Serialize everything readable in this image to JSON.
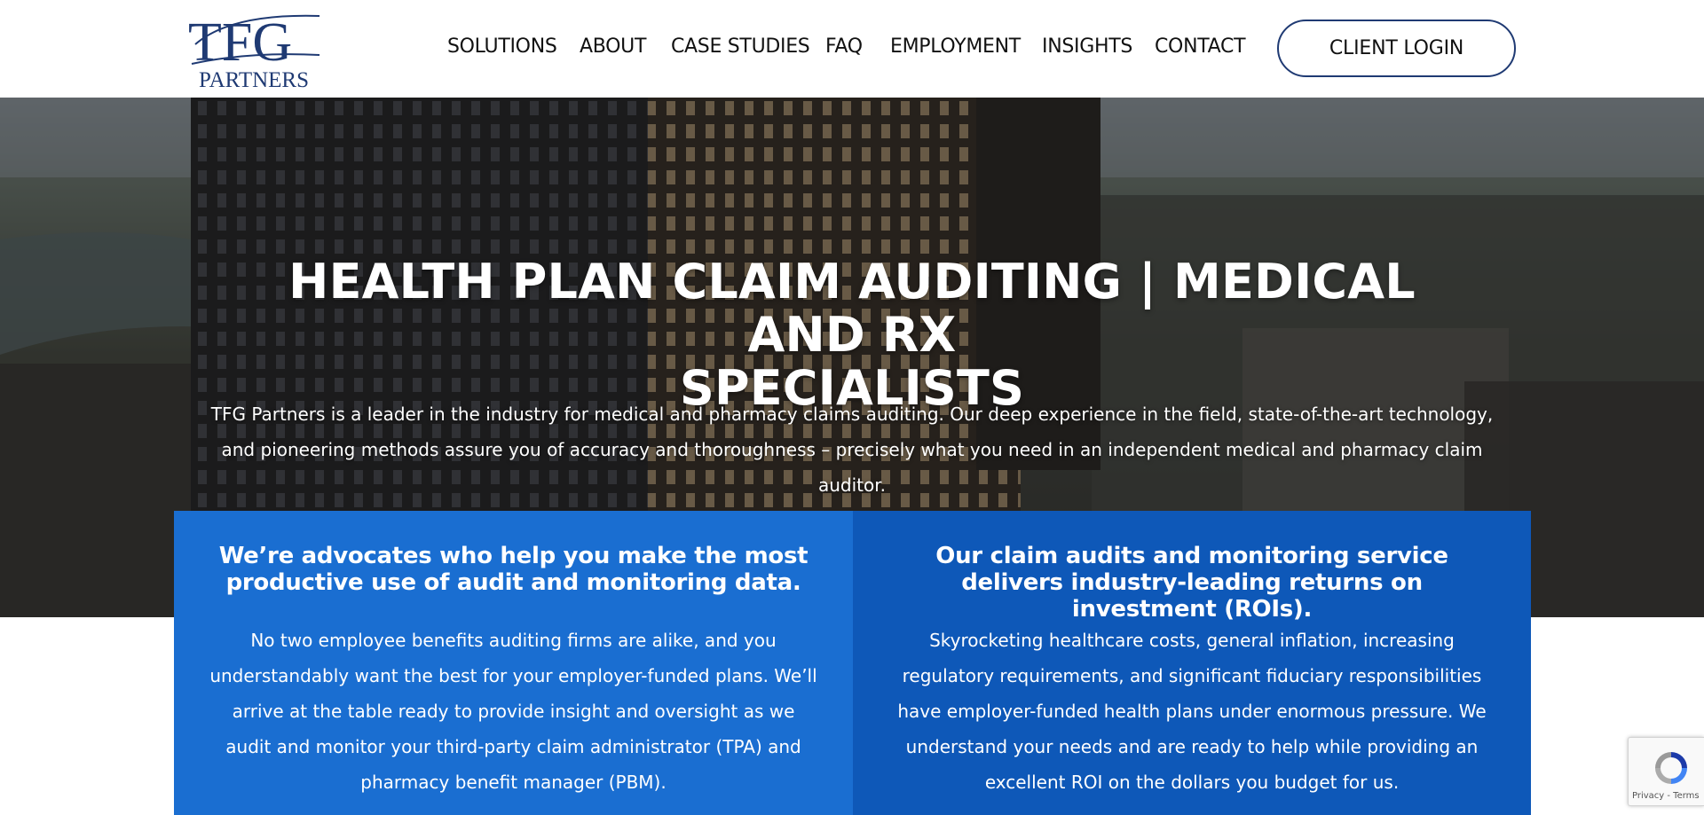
{
  "header": {
    "logo_text": "TFG",
    "logo_subtext": "PARTNERS",
    "nav": [
      {
        "label": "SOLUTIONS"
      },
      {
        "label": "ABOUT"
      },
      {
        "label": "CASE STUDIES"
      },
      {
        "label": "FAQ"
      },
      {
        "label": "EMPLOYMENT"
      },
      {
        "label": "INSIGHTS"
      },
      {
        "label": "CONTACT"
      }
    ],
    "login_label": "CLIENT LOGIN"
  },
  "hero": {
    "title_line1": "HEALTH PLAN CLAIM AUDITING | MEDICAL AND RX",
    "title_line2": "SPECIALISTS",
    "text": "TFG Partners is a leader in the industry for medical and pharmacy claims auditing. Our deep experience in the field, state-of-the-art technology, and pioneering methods assure you of accuracy and thoroughness – precisely what you need in an independent medical and pharmacy claim auditor."
  },
  "features": [
    {
      "title": "We’re advocates who help you make the most productive use of audit and monitoring data.",
      "text": "No two employee benefits auditing firms are alike, and you understandably want the best for your employer-funded plans. We’ll arrive at the table ready to provide insight and oversight as we audit and monitor your third-party claim administrator (TPA) and pharmacy benefit manager (PBM)."
    },
    {
      "title": "Our claim audits and monitoring service delivers industry-leading returns on investment (ROIs).",
      "text": "Skyrocketing healthcare costs, general inflation, increasing regulatory requirements, and significant fiduciary responsibilities have employer-funded health plans under enormous pressure. We understand your needs and are ready to help while providing an excellent ROI on the dollars you budget for us."
    }
  ],
  "recaptcha": {
    "text": "Privacy - Terms"
  },
  "colors": {
    "brand_navy": "#1f3a73",
    "box_left": "#1a6ed1",
    "box_right": "#0e58b8"
  }
}
